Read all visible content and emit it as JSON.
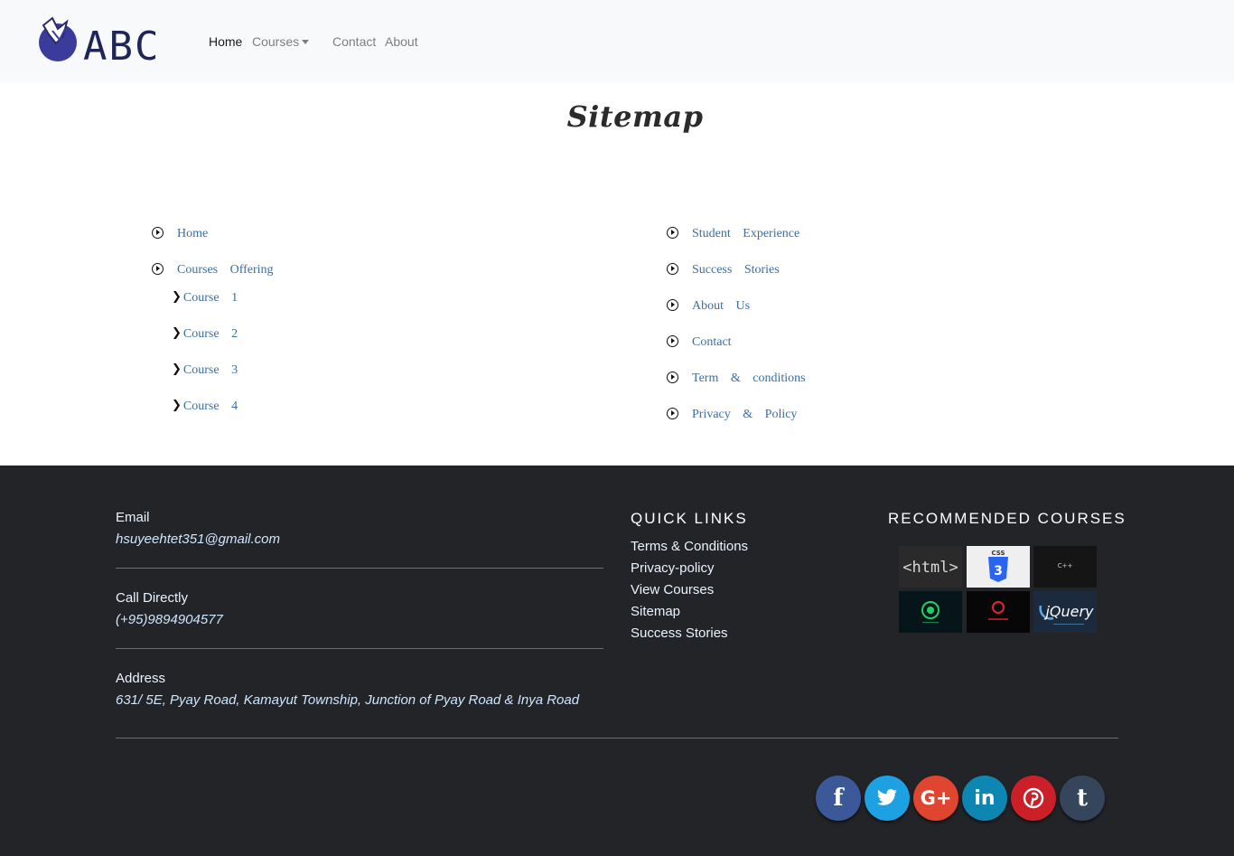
{
  "brand": {
    "logo_text": "ABC"
  },
  "nav": {
    "home": "Home",
    "courses": "Courses",
    "contact": "Contact",
    "about": "About"
  },
  "page_title": "Sitemap",
  "sitemap": {
    "left": {
      "home": "Home",
      "courses_offering": "Courses Offering",
      "courses": [
        "Course 1",
        "Course 2",
        "Course 3",
        "Course 4"
      ]
    },
    "right": [
      "Student Experience",
      "Success Stories",
      "About Us",
      "Contact",
      "Term & conditions",
      "Privacy & Policy"
    ]
  },
  "footer": {
    "email_label": "Email",
    "email_value": "hsuyeehtet351@gmail.com",
    "call_label": "Call Directly",
    "call_value": "(+95)9894904577",
    "address_label": "Address",
    "address_value": "631/ 5E, Pyay Road, Kamayut Township, Junction of Pyay Road & Inya Road",
    "quick_links_heading": "QUICK LINKS",
    "quick_links": [
      "Terms & Conditions",
      "Privacy-policy",
      "View Courses",
      "Sitemap",
      "Success Stories"
    ],
    "recommended_heading": "RECOMMENDED COURSES",
    "recommended_courses": [
      {
        "label": "<html>",
        "icon": "html-thumbnail"
      },
      {
        "label": "CSS",
        "icon": "css3-thumbnail"
      },
      {
        "label": "C++",
        "icon": "cpp-thumbnail"
      },
      {
        "label": "",
        "icon": "green-logo-thumbnail"
      },
      {
        "label": "",
        "icon": "red-logo-thumbnail"
      },
      {
        "label": "jQuery",
        "icon": "jquery-thumbnail"
      }
    ],
    "social": [
      {
        "icon": "facebook-icon",
        "glyph": "f",
        "color": "#3b5998"
      },
      {
        "icon": "twitter-icon",
        "glyph": "🐦",
        "color": "#1da1e2"
      },
      {
        "icon": "google-plus-icon",
        "glyph": "G+",
        "color": "#e0452f"
      },
      {
        "icon": "linkedin-icon",
        "glyph": "in",
        "color": "#0e86b2"
      },
      {
        "icon": "pinterest-icon",
        "glyph": "P",
        "color": "#cb2027"
      },
      {
        "icon": "tumblr-icon",
        "glyph": "t",
        "color": "#35465c"
      }
    ]
  },
  "colors": {
    "navbar_bg": "#f8f9fa",
    "footer_bg": "#232428",
    "link_blue": "#3a6ea5",
    "logo_purple": "#3b3b9c"
  }
}
